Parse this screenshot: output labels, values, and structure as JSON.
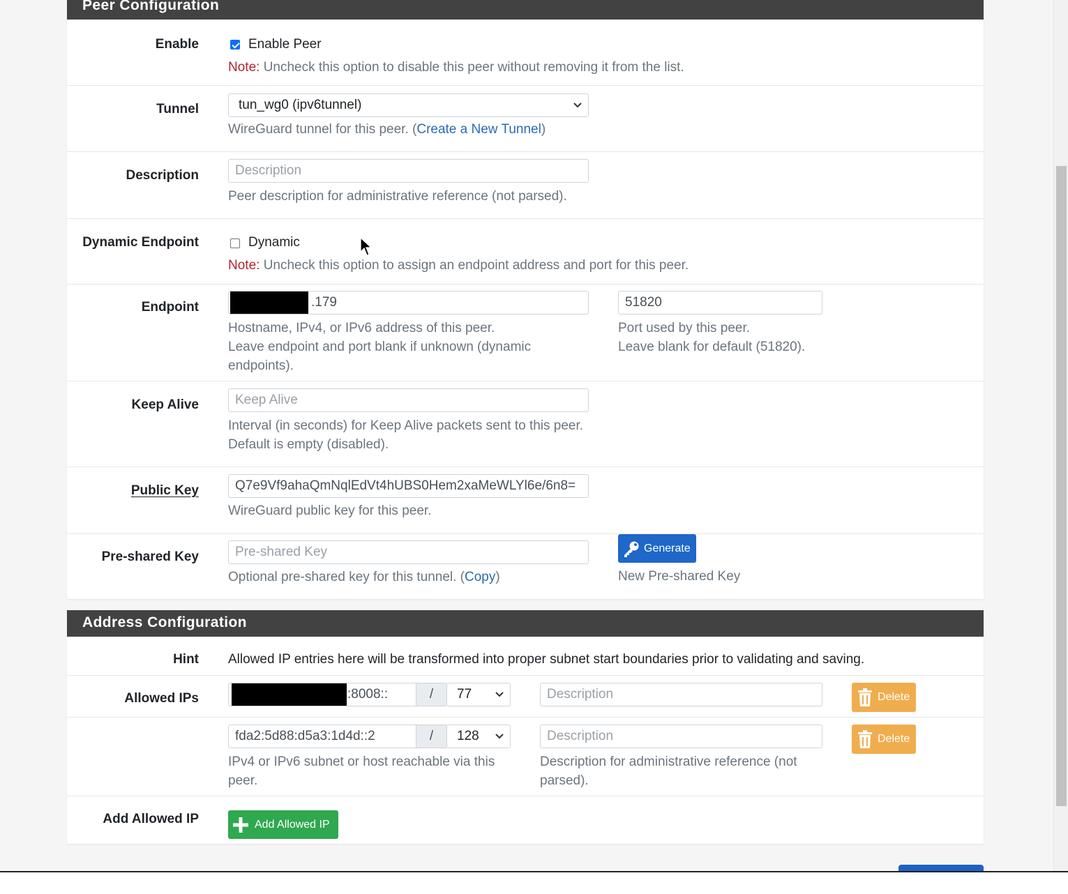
{
  "peer_config": {
    "title": "Peer Configuration",
    "enable": {
      "label": "Enable",
      "checkbox_label": "Enable Peer",
      "checked": true,
      "note_prefix": "Note:",
      "note_text": " Uncheck this option to disable this peer without removing it from the list."
    },
    "tunnel": {
      "label": "Tunnel",
      "selected": "tun_wg0 (ipv6tunnel)",
      "help_prefix": "WireGuard tunnel for this peer. (",
      "help_link": "Create a New Tunnel",
      "help_suffix": ")"
    },
    "description": {
      "label": "Description",
      "placeholder": "Description",
      "help": "Peer description for administrative reference (not parsed)."
    },
    "dynamic_endpoint": {
      "label": "Dynamic Endpoint",
      "checkbox_label": "Dynamic",
      "checked": false,
      "note_prefix": "Note:",
      "note_text": " Uncheck this option to assign an endpoint address and port for this peer."
    },
    "endpoint": {
      "label": "Endpoint",
      "value_visible": ".179",
      "help_line1": "Hostname, IPv4, or IPv6 address of this peer.",
      "help_line2": "Leave endpoint and port blank if unknown (dynamic",
      "help_line3": "endpoints).",
      "port_value": "51820",
      "port_help_line1": "Port used by this peer.",
      "port_help_line2": "Leave blank for default (51820)."
    },
    "keep_alive": {
      "label": "Keep Alive",
      "placeholder": "Keep Alive",
      "help_line1": "Interval (in seconds) for Keep Alive packets sent to this peer.",
      "help_line2": "Default is empty (disabled)."
    },
    "public_key": {
      "label": "Public Key",
      "value": "Q7e9Vf9ahaQmNqlEdVt4hUBS0Hem2xaMeWLYl6e/6n8=",
      "help": "WireGuard public key for this peer."
    },
    "preshared_key": {
      "label": "Pre-shared Key",
      "placeholder": "Pre-shared Key",
      "help_prefix": "Optional pre-shared key for this tunnel. (",
      "help_link": "Copy",
      "help_suffix": ")",
      "generate_label": "Generate",
      "generate_help": "New Pre-shared Key"
    }
  },
  "address_config": {
    "title": "Address Configuration",
    "hint": {
      "label": "Hint",
      "text": "Allowed IP entries here will be transformed into proper subnet start boundaries prior to validating and saving."
    },
    "allowed_ips_label": "Allowed IPs",
    "slash": "/",
    "entries": [
      {
        "address_visible": ":8008::",
        "prefix": "77",
        "description_placeholder": "Description",
        "delete_label": "Delete"
      },
      {
        "address_visible": "fda2:5d88:d5a3:1d4d::2",
        "prefix": "128",
        "description_placeholder": "Description",
        "delete_label": "Delete"
      }
    ],
    "ip_help_line1": "IPv4 or IPv6 subnet or host reachable via this",
    "ip_help_line2": "peer.",
    "desc_help_line1": "Description for administrative reference (not",
    "desc_help_line2": "parsed).",
    "add_label": "Add Allowed IP",
    "add_button": "Add Allowed IP"
  },
  "icons": {
    "key": "key-icon",
    "trash": "trash-icon",
    "plus": "plus-icon",
    "chevron": "chevron-down-icon",
    "cursor": "mouse-cursor-icon"
  },
  "colors": {
    "header_bg": "#424242",
    "note_red": "#b3232f",
    "link_blue": "#2a6bb5",
    "primary": "#1f67c8",
    "warning": "#f0ad4e",
    "success": "#2fa84f"
  }
}
